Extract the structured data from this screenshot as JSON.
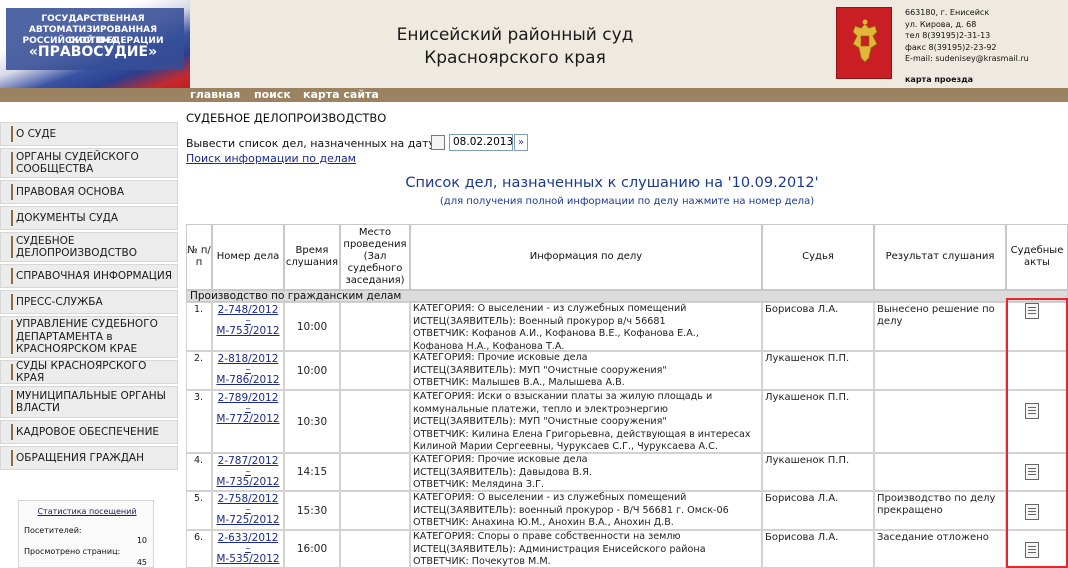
{
  "header": {
    "logo_lines": [
      "ГОСУДАРСТВЕННАЯ",
      "АВТОМАТИЗИРОВАННАЯ СИСТЕМА",
      "РОССИЙСКОЙ ФЕДЕРАЦИИ"
    ],
    "logo_name": "«ПРАВОСУДИЕ»",
    "court_name_line1": "Енисейский районный суд",
    "court_name_line2": "Красноярского края",
    "contacts": [
      "663180, г. Енисейск",
      "ул. Кирова, д. 68",
      "тел 8(39195)2-31-13",
      "факс 8(39195)2-23-92",
      "E-mail: sudenisey@krasmail.ru"
    ],
    "map_link": "карта проезда"
  },
  "topnav": [
    "главная",
    "поиск",
    "карта сайта"
  ],
  "sidebar": {
    "items": [
      "О СУДЕ",
      "ОРГАНЫ СУДЕЙСКОГО СООБЩЕСТВА",
      "ПРАВОВАЯ ОСНОВА",
      "ДОКУМЕНТЫ СУДА",
      "СУДЕБНОЕ ДЕЛОПРОИЗВОДСТВО",
      "СПРАВОЧНАЯ ИНФОРМАЦИЯ",
      "ПРЕСС-СЛУЖБА",
      "УПРАВЛЕНИЕ СУДЕБНОГО ДЕПАРТАМЕНТА в КРАСНОЯРСКОМ КРАЕ",
      "СУДЫ КРАСНОЯРСКОГО КРАЯ",
      "МУНИЦИПАЛЬНЫЕ ОРГАНЫ ВЛАСТИ",
      "КАДРОВОЕ ОБЕСПЕЧЕНИЕ",
      "ОБРАЩЕНИЯ ГРАЖДАН"
    ],
    "stats": {
      "title": "Статистика посещений",
      "visitors_label": "Посетителей:",
      "visitors": "10",
      "pages_label": "Просмотрено страниц:",
      "pages": "45"
    }
  },
  "main": {
    "section_title": "СУДЕБНОЕ ДЕЛОПРОИЗВОДСТВО",
    "date_label": "Вывести список дел, назначенных на дату",
    "date_value": "08.02.2013",
    "go_symbol": "»",
    "search_link": "Поиск информации по делам",
    "list_title": "Список дел, назначенных к слушанию на '10.09.2012'",
    "list_subtitle": "(для получения полной информации по делу нажмите на номер дела)"
  },
  "table": {
    "headers": [
      "№ п/п",
      "Номер дела",
      "Время слушания",
      "Место проведения (Зал судебного заседания)",
      "Информация по делу",
      "Судья",
      "Результат слушания",
      "Судебные акты"
    ],
    "group_label": "Производство по гражданским делам",
    "rows": [
      {
        "num": "1.",
        "case_number": "2-748/2012",
        "case_sep": "~",
        "material_number": "М-753/2012",
        "time": "10:00",
        "info": [
          "КАТЕГОРИЯ: О выселении - из служебных помещений",
          "ИСТЕЦ(ЗАЯВИТЕЛЬ): Военный прокурор в/ч 56681",
          "ОТВЕТЧИК: Кофанов А.И., Кофанова В.Е., Кофанова Е.А.,",
          "Кофанова Н.А., Кофанова Т.А."
        ],
        "judge": "Борисова Л.А.",
        "result": "Вынесено решение по делу",
        "has_act": true
      },
      {
        "num": "2.",
        "case_number": "2-818/2012",
        "case_sep": "~",
        "material_number": "М-786/2012",
        "time": "10:00",
        "info": [
          "КАТЕГОРИЯ: Прочие исковые дела",
          "ИСТЕЦ(ЗАЯВИТЕЛЬ): МУП \"Очистные сооружения\"",
          "ОТВЕТЧИК: Малышев В.А., Малышева А.В."
        ],
        "judge": "Лукашенок П.П.",
        "result": "",
        "has_act": false
      },
      {
        "num": "3.",
        "case_number": "2-789/2012",
        "case_sep": "~",
        "material_number": "М-772/2012",
        "time": "10:30",
        "info": [
          "КАТЕГОРИЯ: Иски о взыскании платы за жилую площадь и",
          "коммунальные платежи, тепло и электроэнергию",
          "ИСТЕЦ(ЗАЯВИТЕЛЬ): МУП \"Очистные сооружения\"",
          "ОТВЕТЧИК: Килина Елена Григорьевна, действующая в интересах",
          "Килиной Марии Сергеевны, Чуруксаев С.Г., Чуруксаева А.С."
        ],
        "judge": "Лукашенок П.П.",
        "result": "",
        "has_act": true
      },
      {
        "num": "4.",
        "case_number": "2-787/2012",
        "case_sep": "~",
        "material_number": "М-735/2012",
        "time": "14:15",
        "info": [
          "КАТЕГОРИЯ: Прочие исковые дела",
          "ИСТЕЦ(ЗАЯВИТЕЛЬ): Давыдова В.Я.",
          "ОТВЕТЧИК: Мелядина З.Г."
        ],
        "judge": "Лукашенок П.П.",
        "result": "",
        "has_act": true
      },
      {
        "num": "5.",
        "case_number": "2-758/2012",
        "case_sep": "~",
        "material_number": "М-725/2012",
        "time": "15:30",
        "info": [
          "КАТЕГОРИЯ: О выселении - из служебных помещений",
          "ИСТЕЦ(ЗАЯВИТЕЛЬ): военный прокурор - В/Ч 56681 г. Омск-06",
          "ОТВЕТЧИК: Анахина Ю.М., Анохин В.А., Анохин Д.В."
        ],
        "judge": "Борисова Л.А.",
        "result": "Производство по делу прекращено",
        "has_act": true
      },
      {
        "num": "6.",
        "case_number": "2-633/2012",
        "case_sep": "~",
        "material_number": "М-535/2012",
        "time": "16:00",
        "info": [
          "КАТЕГОРИЯ: Споры о праве собственности на землю",
          "ИСТЕЦ(ЗАЯВИТЕЛЬ): Администрация Енисейского района",
          "ОТВЕТЧИК: Почекутов М.М."
        ],
        "judge": "Борисова Л.А.",
        "result": "Заседание отложено",
        "has_act": true
      }
    ]
  },
  "colors": {
    "nav_bar": "#9b8260",
    "link": "#1a2a8c",
    "title_blue": "#1b3a8f",
    "highlight_frame": "#e5262a"
  }
}
